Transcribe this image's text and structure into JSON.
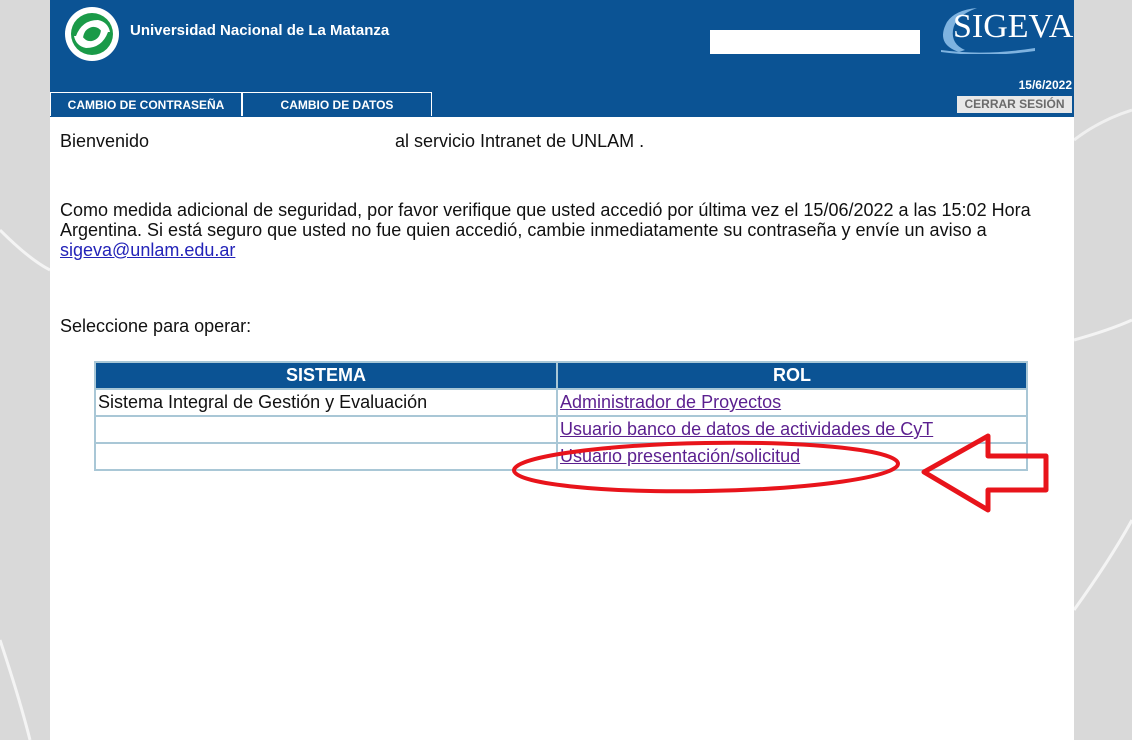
{
  "header": {
    "institution": "Universidad Nacional de La Matanza",
    "brand": "SIGEVA",
    "date": "15/6/2022",
    "logout_label": "CERRAR SESIÓN",
    "tabs": [
      {
        "label": "CAMBIO DE CONTRASEÑA"
      },
      {
        "label": "CAMBIO DE DATOS"
      }
    ]
  },
  "main": {
    "welcome": "Bienvenido",
    "welcome_service": "al servicio Intranet de UNLAM .",
    "security_text": "Como medida adicional de seguridad, por favor verifique que usted accedió por última vez el 15/06/2022 a las 15:02 Hora Argentina. Si está seguro que usted no fue quien accedió, cambie inmediatamente su contraseña y envíe un aviso a",
    "email": "sigeva@unlam.edu.ar",
    "select_label": "Seleccione para operar:",
    "table": {
      "headers": [
        "SISTEMA",
        "ROL"
      ],
      "rows": [
        {
          "sistema": "Sistema Integral de Gestión y Evaluación",
          "rol": "Administrador de Proyectos"
        },
        {
          "sistema": "",
          "rol": "Usuario banco de datos de actividades de CyT"
        },
        {
          "sistema": "",
          "rol": "Usuario presentación/solicitud"
        }
      ]
    }
  },
  "colors": {
    "header_bg": "#0b5394",
    "annotation": "#e8141b",
    "link_visited": "#5b1f8f",
    "table_border": "#a9c7d6"
  }
}
